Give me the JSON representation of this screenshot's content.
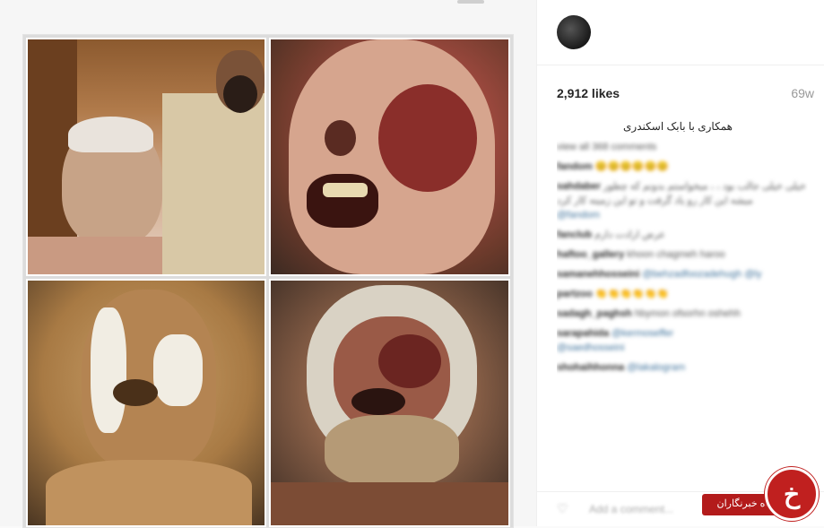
{
  "post": {
    "username": "",
    "likes": "2,912 likes",
    "time_ago": "69w",
    "caption": "همکاری با بابک اسکندری"
  },
  "comments": [
    {
      "user": "",
      "text": "view all 368 comments"
    },
    {
      "user": "",
      "text": "fandom ",
      "emoji": "😊😊😊😊😊😊"
    },
    {
      "user": "sahdaber",
      "text": "خیلی خیلی جالب بود ،  ، میخواستم بدونم که چطور میشه این کار رو یاد گرفت و تو این زمینه کار کرد",
      "link": "@fandom"
    },
    {
      "user": "fanclub",
      "text": "عرض ارادت دارم"
    },
    {
      "user": "haftoo_gallery",
      "text": "khoon chagmeh haroo"
    },
    {
      "user": "samanehhosseini",
      "text": "@behzadfoozadehugh",
      "link": "@ly"
    },
    {
      "user": "partzoo",
      "text": "👏👏👏👏👏👏"
    },
    {
      "user": "sadagh_paghsh",
      "text": "hbymon ofsorhn oshehh"
    },
    {
      "user": "sarapahida",
      "text": "@kermoseffer",
      "link": "@saedhosseini"
    },
    {
      "user": "shohaihhonna",
      "text": "@lakalogram"
    }
  ],
  "add_comment_placeholder": "Add a comment...",
  "watermark": {
    "text": "باشگاه خبرنگاران",
    "glyph": "خ",
    "color": "#c0201f"
  },
  "icons": {
    "heart": "heart-icon",
    "avatar": "avatar",
    "logo": "news-agency-logo-icon"
  }
}
